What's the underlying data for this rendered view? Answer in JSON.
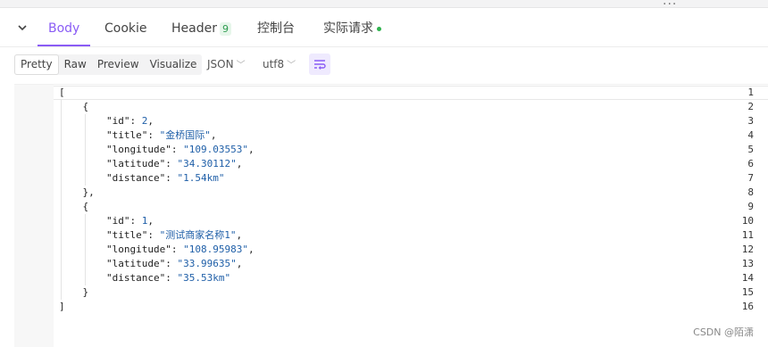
{
  "window": {
    "more_label": "···"
  },
  "tabs": [
    {
      "label": "Body",
      "active": true
    },
    {
      "label": "Cookie"
    },
    {
      "label": "Header",
      "badge": "9"
    },
    {
      "label": "控制台"
    },
    {
      "label": "实际请求"
    }
  ],
  "toolbar": {
    "view_modes": [
      "Pretty",
      "Raw",
      "Preview",
      "Visualize"
    ],
    "selected_view": "Pretty",
    "format": "JSON",
    "encoding": "utf8"
  },
  "code_lines": [
    "[",
    "    {",
    "        \"id\": 2,",
    "        \"title\": \"金桥国际\",",
    "        \"longitude\": \"109.03553\",",
    "        \"latitude\": \"34.30112\",",
    "        \"distance\": \"1.54km\"",
    "    },",
    "    {",
    "        \"id\": 1,",
    "        \"title\": \"测试商家名称1\",",
    "        \"longitude\": \"108.95983\",",
    "        \"latitude\": \"33.99635\",",
    "        \"distance\": \"35.53km\"",
    "    }",
    "]"
  ],
  "line_numbers": [
    "1",
    "2",
    "3",
    "4",
    "5",
    "6",
    "7",
    "8",
    "9",
    "10",
    "11",
    "12",
    "13",
    "14",
    "15",
    "16"
  ],
  "watermark": "CSDN @陌潇",
  "colors": {
    "accent": "#8a5cf5",
    "string": "#1f5fa8",
    "status_dot": "#2fb34e"
  }
}
